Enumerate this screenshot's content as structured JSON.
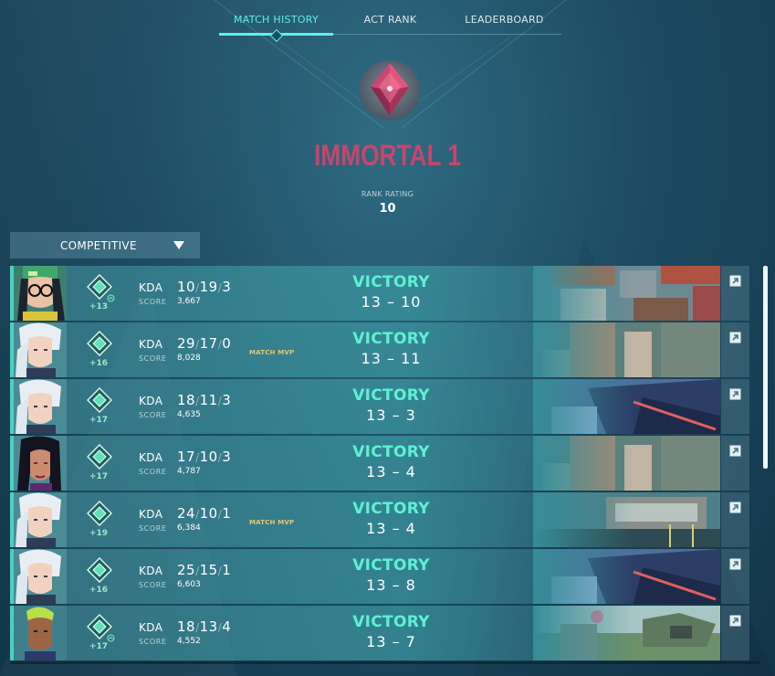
{
  "tabs": [
    {
      "label": "MATCH HISTORY",
      "active": true
    },
    {
      "label": "ACT RANK",
      "active": false
    },
    {
      "label": "LEADERBOARD",
      "active": false
    }
  ],
  "rank": {
    "name": "IMMORTAL 1",
    "rating_label": "RANK RATING",
    "rating_value": "10"
  },
  "queue": {
    "selected": "COMPETITIVE"
  },
  "matches": [
    {
      "agent": "killjoy",
      "rr": "+13",
      "kda_label": "KDA",
      "k": "10",
      "d": "19",
      "a": "3",
      "score_label": "SCORE",
      "score": "3,667",
      "mvp": "",
      "result": "VICTORY",
      "round_score": "13 – 10",
      "map": "bind"
    },
    {
      "agent": "jett",
      "rr": "+16",
      "kda_label": "KDA",
      "k": "29",
      "d": "17",
      "a": "0",
      "score_label": "SCORE",
      "score": "8,028",
      "mvp": "MATCH MVP",
      "result": "VICTORY",
      "round_score": "13 – 11",
      "map": "split"
    },
    {
      "agent": "jett",
      "rr": "+17",
      "kda_label": "KDA",
      "k": "18",
      "d": "11",
      "a": "3",
      "score_label": "SCORE",
      "score": "4,635",
      "mvp": "",
      "result": "VICTORY",
      "round_score": "13 – 3",
      "map": "icebox"
    },
    {
      "agent": "reyna",
      "rr": "+17",
      "kda_label": "KDA",
      "k": "17",
      "d": "10",
      "a": "3",
      "score_label": "SCORE",
      "score": "4,787",
      "mvp": "",
      "result": "VICTORY",
      "round_score": "13 – 4",
      "map": "split"
    },
    {
      "agent": "jett",
      "rr": "+19",
      "kda_label": "KDA",
      "k": "24",
      "d": "10",
      "a": "1",
      "score_label": "SCORE",
      "score": "6,384",
      "mvp": "MATCH MVP",
      "result": "VICTORY",
      "round_score": "13 – 4",
      "map": "breeze"
    },
    {
      "agent": "jett",
      "rr": "+16",
      "kda_label": "KDA",
      "k": "25",
      "d": "15",
      "a": "1",
      "score_label": "SCORE",
      "score": "6,603",
      "mvp": "",
      "result": "VICTORY",
      "round_score": "13 – 8",
      "map": "icebox"
    },
    {
      "agent": "neon",
      "rr": "+17",
      "kda_label": "KDA",
      "k": "18",
      "d": "13",
      "a": "4",
      "score_label": "SCORE",
      "score": "4,552",
      "mvp": "",
      "result": "VICTORY",
      "round_score": "13 – 7",
      "map": "haven"
    }
  ],
  "colors": {
    "victory": "#5df2d2",
    "rank": "#c8456c",
    "accent": "#5ef0e6",
    "mvp": "#e7c66a"
  },
  "icons": {
    "open_match": "external-link-icon",
    "dropdown": "caret-down-icon"
  }
}
